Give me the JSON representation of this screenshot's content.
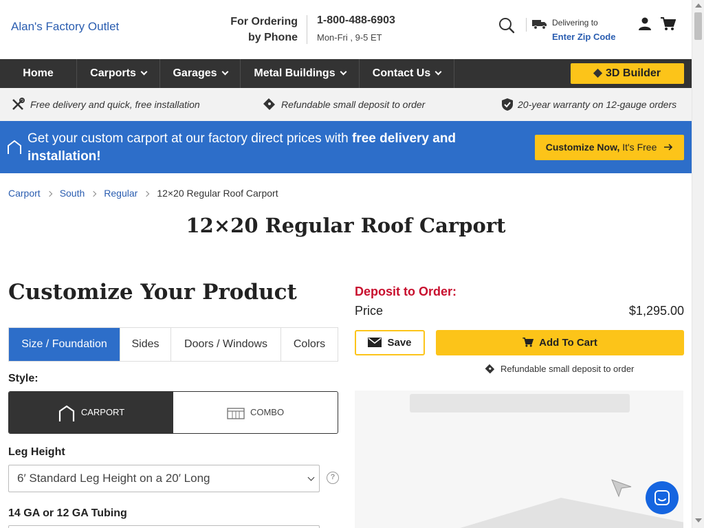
{
  "header": {
    "logo": "Alan's Factory Outlet",
    "order_label": "For Ordering by Phone",
    "phone": "1-800-488-6903",
    "hours": "Mon-Fri , 9-5 ET",
    "delivering_to": "Delivering to",
    "zip_link": "Enter Zip Code",
    "icons": [
      "search-icon",
      "truck-icon",
      "user-icon",
      "cart-icon"
    ]
  },
  "nav": {
    "items": [
      {
        "label": "Home",
        "dropdown": false
      },
      {
        "label": "Carports",
        "dropdown": true
      },
      {
        "label": "Garages",
        "dropdown": true
      },
      {
        "label": "Metal Buildings",
        "dropdown": true
      },
      {
        "label": "Contact Us",
        "dropdown": true
      }
    ],
    "builder": "3D Builder"
  },
  "perks": [
    {
      "icon": "tools-icon",
      "text": "Free delivery and quick, free installation"
    },
    {
      "icon": "ticket-icon",
      "text": "Refundable small deposit to order"
    },
    {
      "icon": "shield-check-icon",
      "text": "20-year warranty on 12-gauge orders"
    }
  ],
  "promo": {
    "text_plain": "Get your custom carport at our factory direct prices with ",
    "text_bold": "free delivery and installation!",
    "button_bold": "Customize Now,",
    "button_rest": " It's Free"
  },
  "breadcrumb": [
    "Carport",
    "South",
    "Regular",
    "12×20 Regular Roof Carport"
  ],
  "page_title": "12×20 Regular Roof Carport",
  "customize": {
    "title": "Customize Your Product",
    "tabs": [
      "Size / Foundation",
      "Sides",
      "Doors / Windows",
      "Colors"
    ],
    "active_tab": "Size / Foundation",
    "style_label": "Style:",
    "style_options": [
      "CARPORT",
      "COMBO"
    ],
    "selected_style": "CARPORT",
    "leg_label": "Leg Height",
    "leg_value": "6′ Standard Leg Height on a 20′ Long",
    "help": "?",
    "gauge_label": "14 GA or 12 GA Tubing"
  },
  "pricing": {
    "deposit_label": "Deposit to Order:",
    "price_label": "Price",
    "price_value": "$1,295.00",
    "save": "Save",
    "add_to_cart": "Add To Cart",
    "refund_note": "Refundable small deposit to order"
  },
  "colors": {
    "brand_blue": "#2d6ec9",
    "link_blue": "#2a5db0",
    "accent_yellow": "#fcc419",
    "nav_dark": "#333333",
    "deposit_red": "#c8102e"
  }
}
